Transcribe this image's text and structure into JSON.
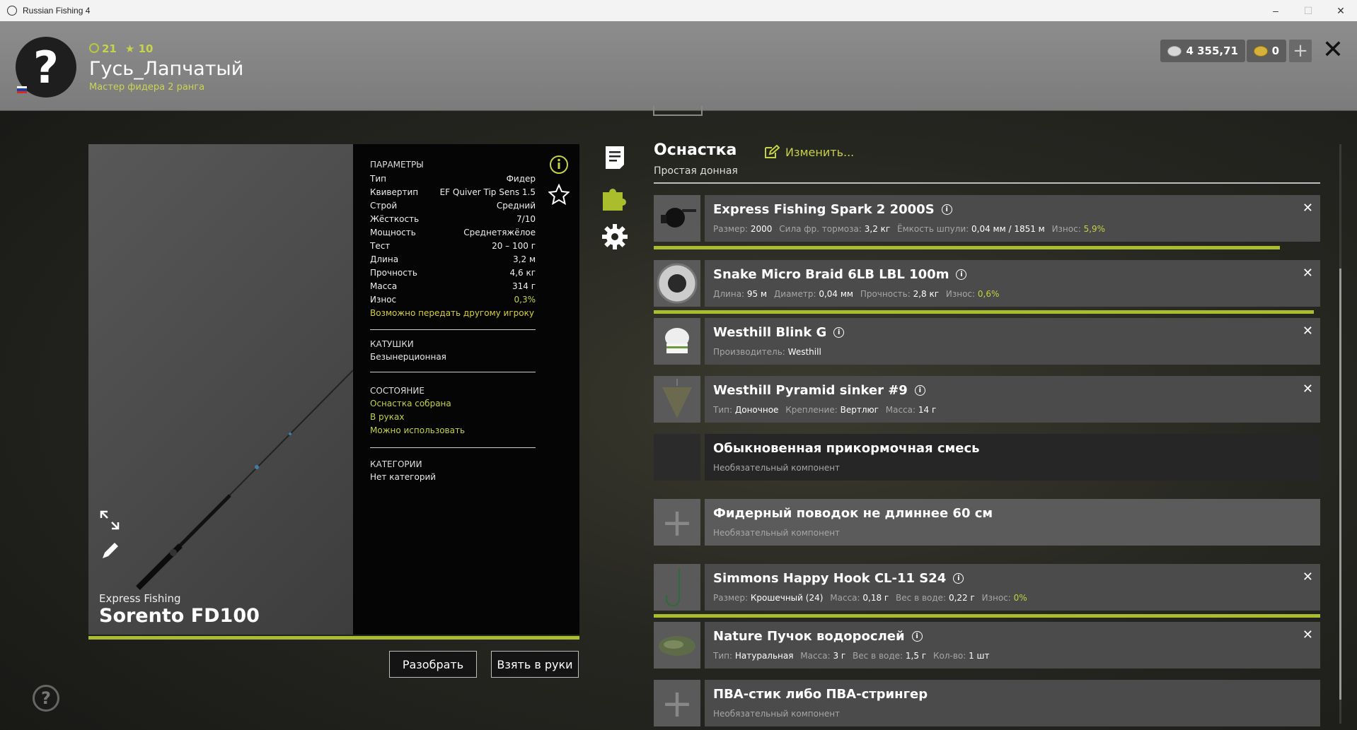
{
  "window": {
    "title": "Russian Fishing 4",
    "minimize": "–",
    "maximize": "☐",
    "close": "✕"
  },
  "player": {
    "level": "21",
    "stars": "10",
    "name": "Гусь_Лапчатый",
    "rank": "Мастер фидера 2 ранга",
    "avatar_glyph": "?"
  },
  "currency": {
    "silver": "4 355,71",
    "gold": "0"
  },
  "rod": {
    "brand": "Express Fishing",
    "name": "Sorento FD100"
  },
  "params": {
    "header": "ПАРАМЕТРЫ",
    "rows": [
      {
        "label": "Тип",
        "value": "Фидер"
      },
      {
        "label": "Квивертип",
        "value": "EF Quiver Tip Sens 1.5"
      },
      {
        "label": "Строй",
        "value": "Средний"
      },
      {
        "label": "Жёсткость",
        "value": "7/10"
      },
      {
        "label": "Мощность",
        "value": "Среднетяжёлое"
      },
      {
        "label": "Тест",
        "value": "20 – 100 г"
      },
      {
        "label": "Длина",
        "value": "3,2 м"
      },
      {
        "label": "Прочность",
        "value": "4,6 кг"
      },
      {
        "label": "Масса",
        "value": "314 г"
      },
      {
        "label": "Износ",
        "value": "0,3%"
      }
    ],
    "transfer_note": "Возможно передать другому игроку",
    "reels_header": "КАТУШКИ",
    "reels_value": "Безынерционная",
    "state_header": "СОСТОЯНИЕ",
    "state_items": [
      "Оснастка собрана",
      "В руках",
      "Можно использовать"
    ],
    "categories_header": "КАТЕГОРИИ",
    "categories_value": "Нет категорий"
  },
  "buttons": {
    "disassemble": "Разобрать",
    "take": "Взять в руки"
  },
  "help": "?",
  "tackle": {
    "title": "Оснастка",
    "subtitle": "Простая донная",
    "edit_label": "Изменить...",
    "items": [
      {
        "name": "Express Fishing Spark 2 2000S",
        "meta": [
          {
            "k": "Размер:",
            "v": "2000"
          },
          {
            "k": "Сила фр. тормоза:",
            "v": "3,2 кг"
          },
          {
            "k": "Ёмкость шпули:",
            "v": "0,04 мм / 1851 м"
          },
          {
            "k": "Износ:",
            "v": "5,9%",
            "g": true
          }
        ]
      },
      {
        "name": "Snake Micro Braid 6LB LBL 100m",
        "meta": [
          {
            "k": "Длина:",
            "v": "95 м"
          },
          {
            "k": "Диаметр:",
            "v": "0,04 мм"
          },
          {
            "k": "Прочность:",
            "v": "2,8 кг"
          },
          {
            "k": "Износ:",
            "v": "0,6%",
            "g": true
          }
        ]
      },
      {
        "name": "Westhill Blink G",
        "meta": [
          {
            "k": "Производитель:",
            "v": "Westhill"
          }
        ]
      },
      {
        "name": "Westhill Pyramid sinker #9",
        "meta": [
          {
            "k": "Тип:",
            "v": "Доночное"
          },
          {
            "k": "Крепление:",
            "v": "Вертлюг"
          },
          {
            "k": "Масса:",
            "v": "14 г"
          }
        ]
      },
      {
        "name": "Обыкновенная прикормочная смесь",
        "optional": "Необязательный компонент"
      },
      {
        "name": "Фидерный поводок не длиннее 60 см",
        "optional": "Необязательный компонент"
      },
      {
        "name": "Simmons Happy Hook CL-11 S24",
        "meta": [
          {
            "k": "Размер:",
            "v": "Крошечный (24)"
          },
          {
            "k": "Масса:",
            "v": "0,18 г"
          },
          {
            "k": "Вес в воде:",
            "v": "0,22 г"
          },
          {
            "k": "Износ:",
            "v": "0%",
            "g": true
          }
        ]
      },
      {
        "name": "Nature Пучок водорослей",
        "meta": [
          {
            "k": "Тип:",
            "v": "Натуральная"
          },
          {
            "k": "Масса:",
            "v": "3 г"
          },
          {
            "k": "Вес в воде:",
            "v": "1,5 г"
          },
          {
            "k": "Кол-во:",
            "v": "1 шт"
          }
        ]
      },
      {
        "name": "ПВА-стик либо ПВА-стрингер",
        "optional": "Необязательный компонент"
      }
    ],
    "remove_glyph": "✕",
    "add_glyph": "+"
  },
  "durability": {
    "reel": 0.94,
    "line": 0.99,
    "hook": 1.0
  },
  "colors": {
    "accent": "#a9bd2d",
    "label_green": "#c4d243"
  }
}
